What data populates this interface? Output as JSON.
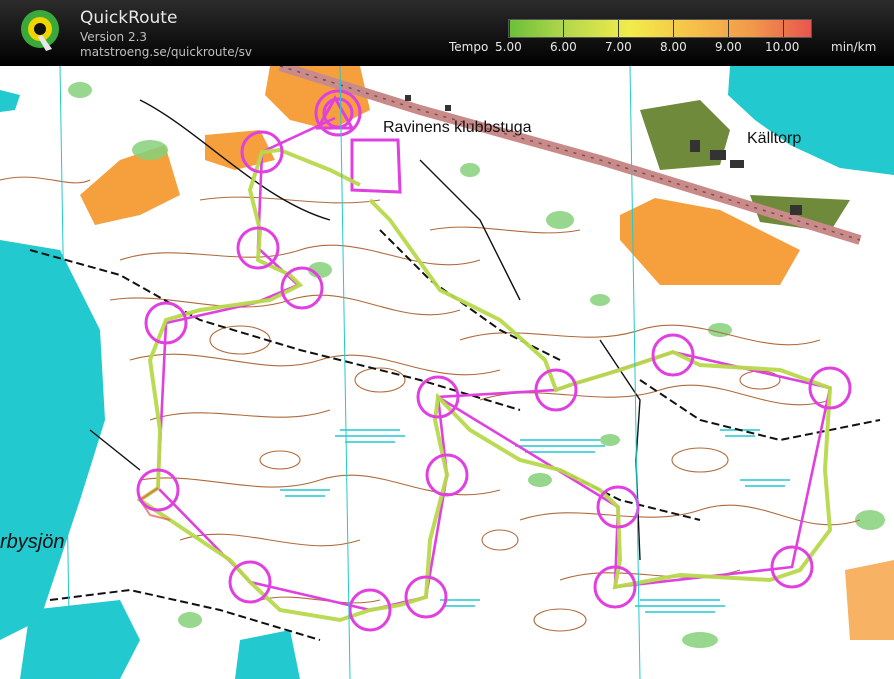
{
  "app": {
    "name": "QuickRoute",
    "version": "Version 2.3",
    "url": "matstroeng.se/quickroute/sv"
  },
  "legend": {
    "label": "Tempo",
    "ticks": [
      "5.00",
      "6.00",
      "7.00",
      "8.00",
      "9.00",
      "10.00"
    ],
    "unit": "min/km"
  },
  "map": {
    "labels": {
      "clubhouse": "Ravinens klubbstuga",
      "kalltorp": "Källtorp",
      "lake": "rbysjön"
    },
    "colors": {
      "course": "#e040e0",
      "water": "#22c9cf",
      "open_land": "#f5a03c",
      "contours": "#b06a3a",
      "vegetation": "#86d07a",
      "road": "#c98a8a"
    }
  }
}
